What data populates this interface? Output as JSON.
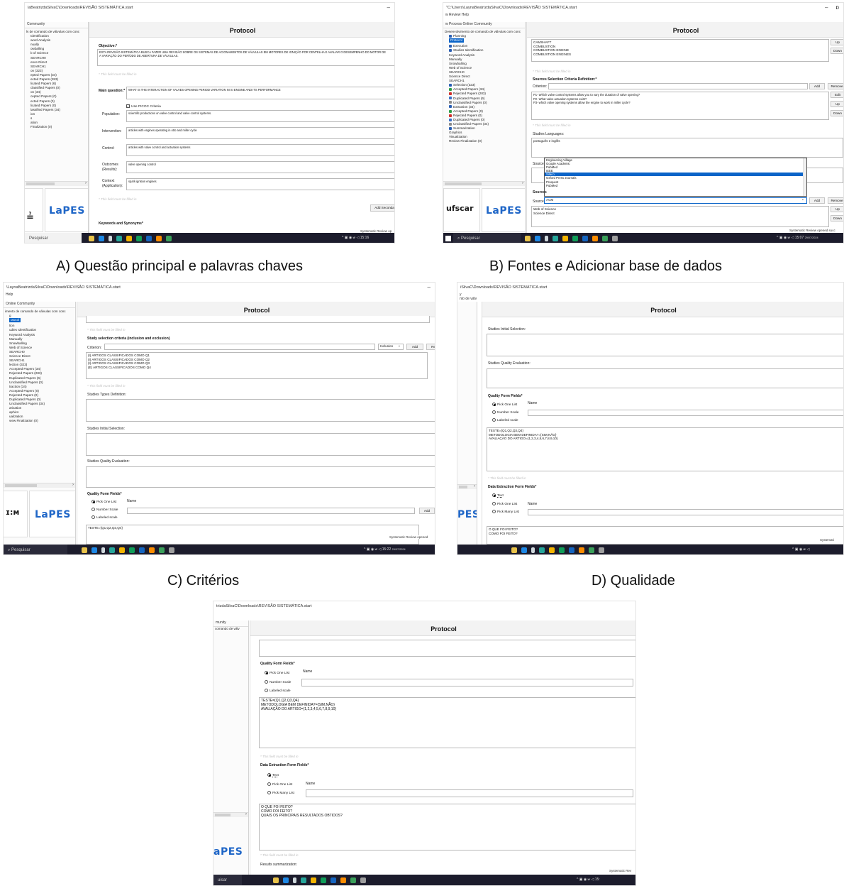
{
  "captions": {
    "a": "A) Questão principal e palavras chaves",
    "b": "B) Fontes e Adicionar base de dados",
    "c": "C) Critérios",
    "d": "D) Qualidade"
  },
  "common": {
    "protocol_title": "Protocol",
    "search_placeholder": "Pesquisar",
    "status": "Systematic Review opened successfully",
    "required_note": "* This field must be filled in",
    "tray_time": "15:22",
    "tray_date": "29/07/2024",
    "lapes_logo": "LaPES",
    "ufscar_logo": "ufscar"
  },
  "panel_a": {
    "title": "laBeatrizdaSilvaC\\Downloads\\REVISÃO SISTEMÁTICA.start",
    "menu": "",
    "tabs": "Community",
    "tree": [
      "ls de comando de válvulas com conc",
      "",
      "Identification",
      "word Analysis",
      "nually",
      "owballing",
      "b of Science",
      "SEARCH0",
      "ence Direct",
      "SEARCH1",
      "on (323)",
      "epted Papers (34)",
      "ected Papers (283)",
      "licated Papers (6)",
      "classified Papers (0)",
      "on (34)",
      "cepted Papers (0)",
      "ected Papers (0)",
      "licated Papers (0)",
      "lassified Papers (34)",
      "ion",
      "s",
      "ation",
      "Finalization (0)"
    ],
    "objective_label": "Objective:*",
    "objective_text": "ESTA REVISÃO SISTEMÁTICA BUSCA FAZER UMA REVISÃO SOBRE OS SISTEMAS DE ACIONAMENTOS DE VÁLVULAS EM MOTORES DE IGNIÇÃO POR CENTELHA E AVALIAR O DESEMPENHO DO MOTOR DE\nA VARIAÇÃO DO PERÍODO DE ABERTURA DE VÁLVULAS.",
    "main_question_label": "Main question:*",
    "main_question_text": "WHAT IS THE INTERACTION OF VALVES OPENING PERIOD VARIATION IN SI ENGINE AND ITS PERFORMANCE",
    "picoc_label": "Use PICOC Criteria",
    "population_label": "Population:",
    "population_text": "scientific productions on valve control and valve control systems.",
    "intervention_label": "Intervention:",
    "intervention_text": "articles with engines operating in otto and miller cycle",
    "control_label": "Control:",
    "control_text": "articles with valve control and actuation systems",
    "outcomes_label": "Outcomes\n(Results):",
    "outcomes_text": "valve opening control",
    "context_label": "Context\n(Application):",
    "context_text": "spark ignition engines",
    "add_button": "Add Seconda",
    "keywords_label": "Keywords and Synonyms*",
    "status": "Systematic Review op"
  },
  "panel_b": {
    "title": "\"C:\\Users\\LaynaBeatrizdaSilvaC\\Downloads\\REVISÃO SISTEMÁTICA.start",
    "menu": "w  Review  Help",
    "tabs": "w Process  Online Community",
    "tree": [
      "Desenvolvimento de comando de válvulas com conc",
      "Planning",
      "Protocol",
      "Execution",
      "Studies Identification",
      "Keyword Analysis",
      "Manually",
      "Snowballing",
      "Web of Science",
      "SEARCH0",
      "Science Direct",
      "SEARCH1",
      "Selection (323)",
      "Accepted Papers (34)",
      "Rejected Papers (283)",
      "Duplicated Papers (6)",
      "Unclassified Papers (0)",
      "Extraction (34)",
      "Accepted Papers (0)",
      "Rejected Papers (0)",
      "Duplicated Papers (0)",
      "Unclassified Papers (34)",
      "Summarization",
      "Graphics",
      "Visualization",
      "Review Finalization (0)"
    ],
    "keywords": [
      "CAMSHAFT",
      "COMBUSTION",
      "COMBUSTION ENGINE",
      "COMBUSTION ENGINES"
    ],
    "up": "Up",
    "down": "Down",
    "add": "Add",
    "remove": "Remove",
    "edit": "Edit",
    "source_criteria_label": "Sources Selection Criteria Definition:*",
    "criterion_label": "Criterion:",
    "criteria": [
      "P1- Which valve control systems allow you to vary the duration of valve opening?",
      "P2- What valve actuation systems exist?",
      "P3- which valve opening systems allow the engine to work in miller cycle?"
    ],
    "languages_label": "Studies Languages:",
    "languages_text": "português e inglês",
    "sources_label": "Sources",
    "source_label": "Source:",
    "source_value": "ACM",
    "dropdown": [
      "Engineering Village",
      "Google Academic",
      "PubMed",
      "IEEE",
      "Silaco",
      "Oxford Press Journals",
      "Proquest",
      "PubMed"
    ],
    "sources_list": [
      "Web of Science",
      "Science Direct"
    ],
    "status": "Systematic Review opened succ",
    "tray_time": "15:07",
    "tray_date": "29/07/2024"
  },
  "panel_c": {
    "title": "\\LaynaBeatrizdaSilvaC\\Downloads\\REVISÃO SISTEMÁTICA.start",
    "menu": "Help",
    "tabs": "Online Community",
    "tree": [
      "imento de comando de válvulas com conc",
      "g",
      "otocol",
      "tion",
      "udies Identification",
      "Keyword Analysis",
      "Manually",
      "Snowballing",
      "Web of Science",
      "SEARCH0",
      "Science Direct",
      "SEARCH1",
      "lection (323)",
      "Accepted Papers (34)",
      "Rejected Papers (283)",
      "Duplicated Papers (6)",
      "Unclassified Papers (0)",
      "traction (34)",
      "Accepted Papers (0)",
      "Rejected Papers (0)",
      "Duplicated Papers (0)",
      "Unclassified Papers (34)",
      "arization",
      "aphics",
      "ualization",
      "view Finalization (0)"
    ],
    "criteria_label": "Study selection criteria (inclusion and exclusion)",
    "criterion_label": "Criterion:",
    "inclusion": "Inclusion",
    "add": "Add",
    "criteria": [
      "(I) ARTIGOS CLASSIFICADOS COMO Q1",
      "(I) ARTIGOS CLASSIFICADOS COMO Q2",
      "(I) ARTIGOS CLASSIFICADOS COMO Q3",
      "(E) ARTIGOS CLASSIFICADOS COMO Q4"
    ],
    "types_label": "Studies Types Definition:",
    "initial_label": "Studies Initial Selection:",
    "quality_label": "Studies Quality Evaluation:",
    "form_label": "Quality Form Fields*",
    "pick_one": "Pick One List",
    "number_scale": "Number Scale",
    "labeled_scale": "Labeled scale",
    "name_label": "Name",
    "form_text": "TESTE={Q1,Q2,Q3,Q4}",
    "status": "Systematic Review opened"
  },
  "panel_d": {
    "title": "iSilvaC\\Downloads\\REVISÃO SISTEMÁTICA.start",
    "menu": "y\nnto de válv",
    "initial_label": "Studies Initial Selection:",
    "quality_label": "Studies Quality Evaluation:",
    "form_label": "Quality Form Fields*",
    "pick_one": "Pick One List",
    "number_scale": "Number Scale",
    "labeled_scale": "Labeled scale",
    "name_label": "Name",
    "form_lines": [
      "TESTE={Q1,Q2,Q3,Q4}",
      "METODOLOGIA BEM DEFINIDA?={SIM,NÃO}",
      "AVALIAÇÃO DO ARTIGO={1,2,3,4,5,6,7,8,9,10}"
    ],
    "extraction_label": "Data Extraction Form Fields*",
    "text_opt": "Text",
    "pick_many": "Pick Many List",
    "extraction_lines": [
      "O QUE FOI FEITO?",
      "COMO FOI FEITO?"
    ],
    "status": "Systemati",
    "lapes_partial": "PES"
  },
  "panel_e": {
    "title": "trizdaSilvaC\\Downloads\\REVISÃO SISTEMÁTICA.start",
    "tabs": "munity",
    "tree0": "comando de válv",
    "form_label": "Quality Form Fields*",
    "pick_one": "Pick One List",
    "number_scale": "Number Scale",
    "labeled_scale": "Labeled scale",
    "name_label": "Name",
    "form_lines": [
      "TESTE={Q1,Q2,Q3,Q4}",
      "METODOLOGIA BEM DEFINIDA?={SIM,NÃO}",
      "AVALIAÇÃO DO ARTIGO={1,2,3,4,5,6,7,8,9,10}"
    ],
    "extraction_label": "Data Extraction Form Fields*",
    "text_opt": "Text",
    "pick_many": "Pick Many List",
    "extraction_lines": [
      "O QUE FOI FEITO?",
      "COMO FOI FEITO?",
      "QUAIS OS PRINCIPAIS RESULTADOS OBTIDOS?"
    ],
    "summarization_label": "Results summarization:",
    "status": "Systematic Rev",
    "search_partial": "uisar",
    "lapes_partial": "aPES",
    "tray_time": "15:"
  }
}
